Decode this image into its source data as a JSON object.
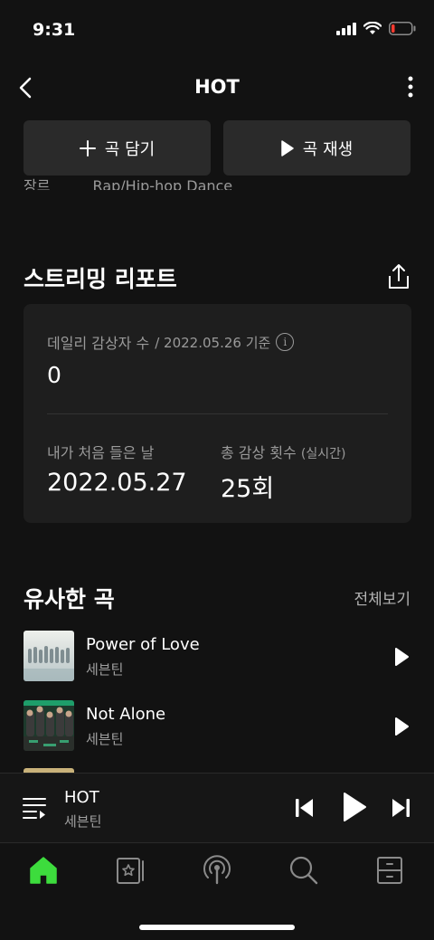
{
  "status": {
    "time": "9:31"
  },
  "header": {
    "title": "HOT"
  },
  "genre_row": {
    "label": "장르",
    "value": "Rap/Hip-hop Dance"
  },
  "actions": {
    "add_label": "곡 담기",
    "play_label": "곡 재생"
  },
  "report": {
    "title": "스트리밍 리포트",
    "daily_label": "데일리 감상자 수",
    "daily_date": "/ 2022.05.26 기준",
    "daily_value": "0",
    "first_listen_label": "내가 처음 들은 날",
    "first_listen_value": "2022.05.27",
    "total_label": "총 감상 횟수",
    "total_label_note": "(실시간)",
    "total_value": "25회"
  },
  "similar": {
    "title": "유사한 곡",
    "see_all": "전체보기",
    "tracks": [
      {
        "title": "Power of Love",
        "artist": "세븐틴"
      },
      {
        "title": "Not Alone",
        "artist": "세븐틴"
      }
    ]
  },
  "mini_player": {
    "title": "HOT",
    "artist": "세븐틴"
  },
  "colors": {
    "accent": "#3ddc3d",
    "background": "#121212",
    "card": "#1e1e1e"
  }
}
